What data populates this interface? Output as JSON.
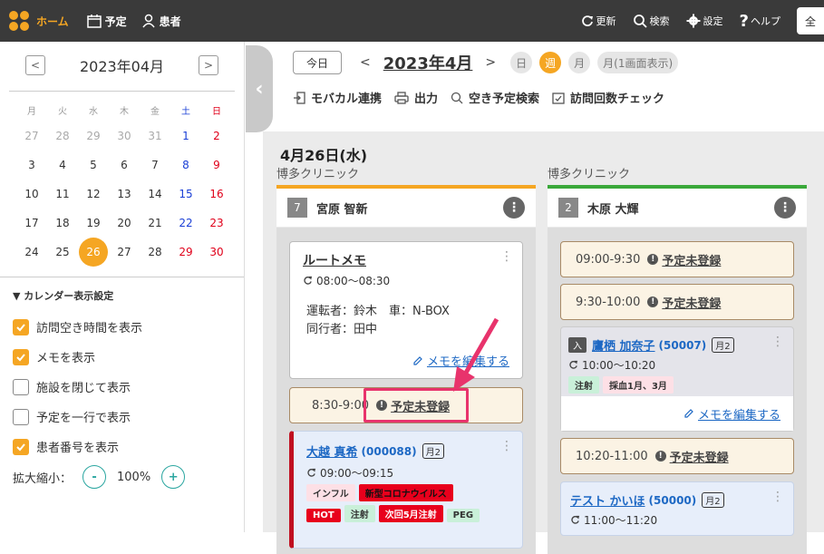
{
  "topbar": {
    "nav": [
      {
        "label": "ホーム"
      },
      {
        "label": "予定"
      },
      {
        "label": "患者"
      }
    ],
    "actions": [
      {
        "label": "更新"
      },
      {
        "label": "検索"
      },
      {
        "label": "設定"
      },
      {
        "label": "ヘルプ"
      }
    ],
    "edge_label": "全"
  },
  "mini_calendar": {
    "title": "2023年04月",
    "prev": "<",
    "next": ">",
    "weekdays": [
      "月",
      "火",
      "水",
      "木",
      "金",
      "土",
      "日"
    ],
    "weeks": [
      [
        "27",
        "28",
        "29",
        "30",
        "31",
        "1",
        "2"
      ],
      [
        "3",
        "4",
        "5",
        "6",
        "7",
        "8",
        "9"
      ],
      [
        "10",
        "11",
        "12",
        "13",
        "14",
        "15",
        "16"
      ],
      [
        "17",
        "18",
        "19",
        "20",
        "21",
        "22",
        "23"
      ],
      [
        "24",
        "25",
        "26",
        "27",
        "28",
        "29",
        "30"
      ]
    ],
    "today": "26"
  },
  "settings": {
    "title": "▼ カレンダー表示設定",
    "options": [
      {
        "label": "訪問空き時間を表示",
        "checked": true
      },
      {
        "label": "メモを表示",
        "checked": true
      },
      {
        "label": "施設を閉じて表示",
        "checked": false
      },
      {
        "label": "予定を一行で表示",
        "checked": false
      },
      {
        "label": "患者番号を表示",
        "checked": true
      }
    ],
    "zoom_label": "拡大縮小：",
    "zoom_value": "100%",
    "zoom_minus": "-",
    "zoom_plus": "+"
  },
  "toolbar": {
    "today": "今日",
    "month": "2023年4月",
    "views": [
      "日",
      "週",
      "月",
      "月(1画面表示)"
    ],
    "active_view": "週",
    "tools": [
      "モバカル連携",
      "出力",
      "空き予定検索",
      "訪問回数チェック"
    ]
  },
  "date_heading": "4月26日(水)",
  "columns": [
    {
      "clinic": "博多クリニック",
      "num": "7",
      "staff": "宮原 智新",
      "accent": "#f5a623",
      "memo": {
        "title": "ルートメモ",
        "time": "08:00〜08:30",
        "line1": "運転者：鈴木　車：N-BOX",
        "line2": "同行者：田中",
        "edit": "メモを編集する"
      },
      "slot": {
        "time": "8:30-9:00",
        "status": "予定未登録"
      },
      "patient": {
        "name": "大越 真希",
        "id": "(000088)",
        "month": "月2",
        "time": "09:00〜09:15",
        "tags1": [
          "インフル",
          "新型コロナウイルス"
        ],
        "tags2": [
          "HOT",
          "注射",
          "次回5月注射",
          "PEG"
        ]
      }
    },
    {
      "clinic": "博多クリニック",
      "num": "2",
      "staff": "木原 大輝",
      "accent": "#3aa83a",
      "slots": [
        {
          "time": "09:00-9:30",
          "status": "予定未登録"
        },
        {
          "time": "9:30-10:00",
          "status": "予定未登録"
        },
        {
          "time": "10:20-11:00",
          "status": "予定未登録"
        }
      ],
      "patient1": {
        "badge": "入",
        "name": "鷹栖 加奈子",
        "id": "(50007)",
        "month": "月2",
        "time": "10:00〜10:20",
        "tags": [
          "注射",
          "採血1月、3月"
        ],
        "edit": "メモを編集する"
      },
      "patient2": {
        "name": "テスト かいほ",
        "id": "(50000)",
        "month": "月2",
        "time": "11:00〜11:20"
      }
    }
  ],
  "colors": {
    "accent": "#f5a623",
    "highlight": "#e8336c",
    "link": "#1d68c4",
    "dark": "#3a3a3a"
  }
}
